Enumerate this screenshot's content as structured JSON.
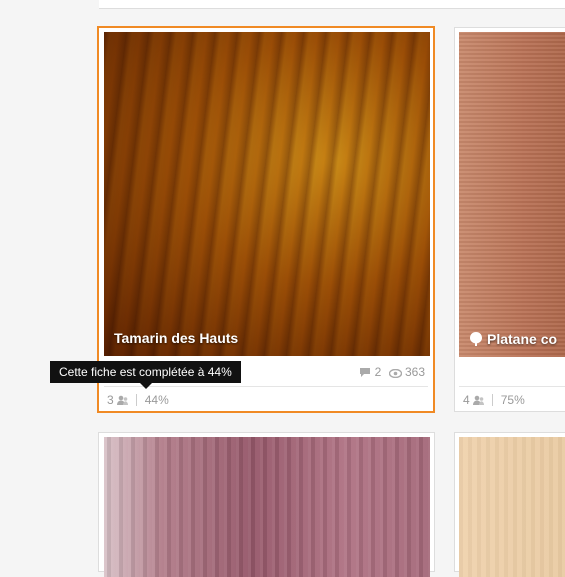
{
  "cards": [
    {
      "title": "Tamarin des Hauts",
      "comments": "2",
      "views": "363",
      "contributors": "3",
      "completion": "44%",
      "selected": true
    },
    {
      "title": "Platane co",
      "contributors": "4",
      "completion": "75%",
      "selected": false
    }
  ],
  "tooltip": {
    "text": "Cette fiche est complétée à 44%"
  },
  "colors": {
    "selected_border": "#f08a24",
    "tooltip_bg": "#111111",
    "muted_text": "#999999"
  },
  "icons": [
    "comment-icon",
    "eye-icon",
    "user-icon",
    "tree-leaf-icon"
  ]
}
